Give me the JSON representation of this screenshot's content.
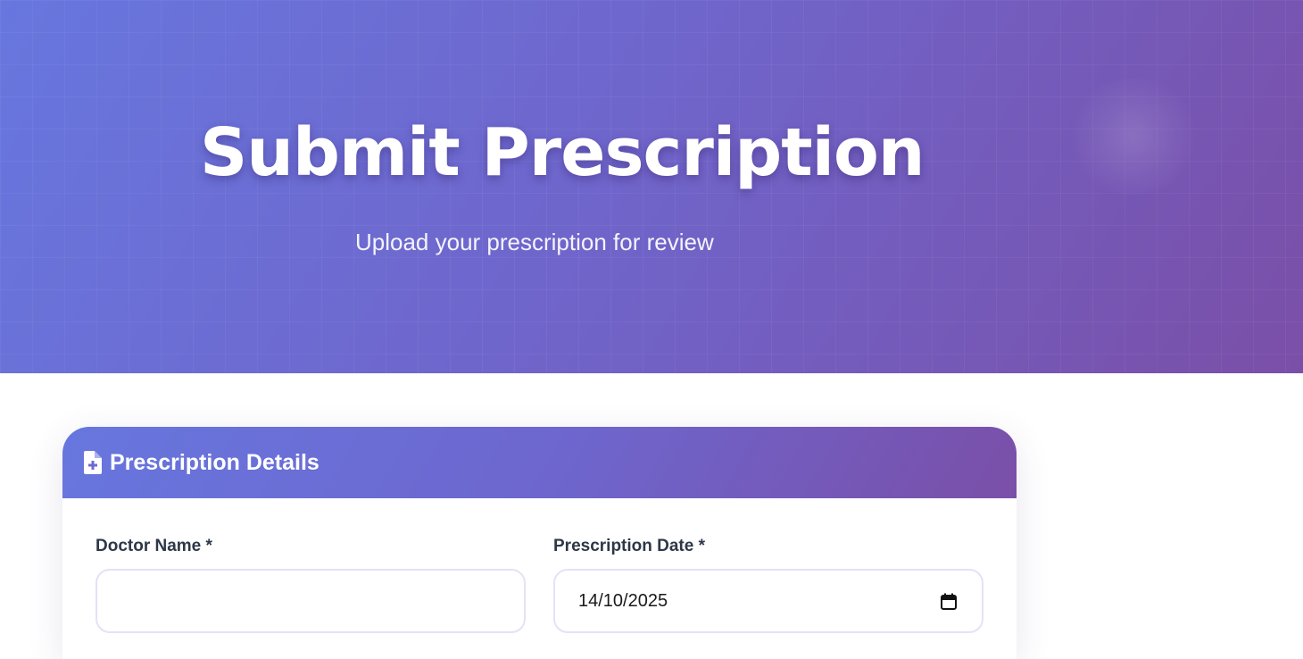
{
  "hero": {
    "title": "Submit Prescription",
    "subtitle": "Upload your prescription for review"
  },
  "card": {
    "icon": "file-medical-icon",
    "title": "Prescription Details",
    "fields": {
      "doctor_name": {
        "label": "Doctor Name *",
        "value": ""
      },
      "prescription_date": {
        "label": "Prescription Date *",
        "value": "14/10/2025",
        "icon": "calendar-icon"
      }
    }
  },
  "colors": {
    "gradient_start": "#6777de",
    "gradient_end": "#7a4fa8",
    "label_text": "#2d3748",
    "input_border": "#e2e3f5"
  }
}
